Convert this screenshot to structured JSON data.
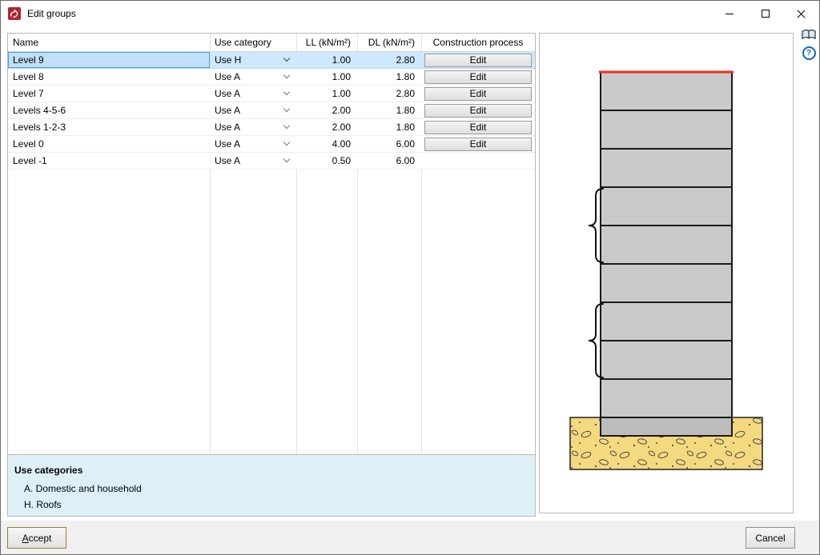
{
  "window": {
    "title": "Edit groups"
  },
  "icons": {
    "help_glyph": "?"
  },
  "table": {
    "columns": [
      "Name",
      "Use category",
      "LL (kN/m²)",
      "DL (kN/m²)",
      "Construction process"
    ],
    "rows": [
      {
        "name": "Level 9",
        "use_category": "Use H",
        "ll": "1.00",
        "dl": "2.80",
        "edit": "Edit",
        "selected": true
      },
      {
        "name": "Level 8",
        "use_category": "Use A",
        "ll": "1.00",
        "dl": "1.80",
        "edit": "Edit",
        "selected": false
      },
      {
        "name": "Level 7",
        "use_category": "Use A",
        "ll": "1.00",
        "dl": "2.80",
        "edit": "Edit",
        "selected": false
      },
      {
        "name": "Levels 4-5-6",
        "use_category": "Use A",
        "ll": "2.00",
        "dl": "1.80",
        "edit": "Edit",
        "selected": false
      },
      {
        "name": "Levels 1-2-3",
        "use_category": "Use A",
        "ll": "2.00",
        "dl": "1.80",
        "edit": "Edit",
        "selected": false
      },
      {
        "name": "Level 0",
        "use_category": "Use A",
        "ll": "4.00",
        "dl": "6.00",
        "edit": "Edit",
        "selected": false
      },
      {
        "name": "Level -1",
        "use_category": "Use A",
        "ll": "0.50",
        "dl": "6.00",
        "edit": null,
        "selected": false
      }
    ]
  },
  "legend": {
    "title": "Use categories",
    "items": [
      "A. Domestic and household",
      "H. Roofs"
    ]
  },
  "footer": {
    "accept_label": "Accept",
    "cancel_label": "Cancel"
  },
  "colors": {
    "selection_blue": "#cde8ff",
    "building_gray": "#c9c9c9",
    "soil_yellow": "#f5d97e",
    "roof_red": "#f02b20",
    "legend_bg": "#def0f7"
  }
}
